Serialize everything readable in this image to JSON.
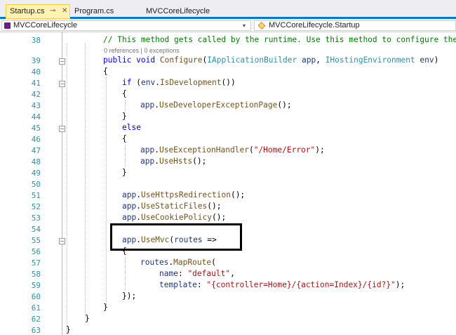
{
  "tabs": [
    {
      "label": "Startup.cs",
      "pin": "⊸",
      "close": "✕",
      "active": true
    },
    {
      "label": "Program.cs",
      "active": false
    },
    {
      "label": "MVCCoreLifecycle",
      "active": false
    }
  ],
  "navbar": {
    "project": "MVCCoreLifecycle",
    "member": "MVCCoreLifecycle.Startup",
    "dropdown_glyph": "▾"
  },
  "codelens": "0 references | 0 exceptions",
  "line_numbers": [
    "38",
    "39",
    "40",
    "41",
    "42",
    "43",
    "44",
    "45",
    "46",
    "47",
    "48",
    "49",
    "50",
    "51",
    "52",
    "53",
    "54",
    "55",
    "56",
    "57",
    "58",
    "59",
    "60",
    "61",
    "62",
    "63"
  ],
  "code": {
    "l38": "// This method gets called by the runtime. Use this method to configure the",
    "l39_public": "public",
    "l39_void": "void",
    "l39_method": "Configure",
    "l39_type1": "IApplicationBuilder",
    "l39_p1": "app",
    "l39_type2": "IHostingEnvironment",
    "l39_p2": "env",
    "l41_if": "if",
    "l41_p": "env",
    "l41_m": "IsDevelopment",
    "l43_p": "app",
    "l43_m": "UseDeveloperExceptionPage",
    "l45_else": "else",
    "l47_p": "app",
    "l47_m": "UseExceptionHandler",
    "l47_s": "\"/Home/Error\"",
    "l48_p": "app",
    "l48_m": "UseHsts",
    "l51_m": "UseHttpsRedirection",
    "l52_m": "UseStaticFiles",
    "l53_m": "UseCookiePolicy",
    "l55_m": "UseMvc",
    "l55_p": "routes",
    "l57_p": "routes",
    "l57_m": "MapRoute",
    "l58_name": "name",
    "l58_s": "\"default\"",
    "l59_t": "template",
    "l59_s": "\"{controller=Home}/{action=Index}/{id?}\"",
    "app": "app"
  }
}
